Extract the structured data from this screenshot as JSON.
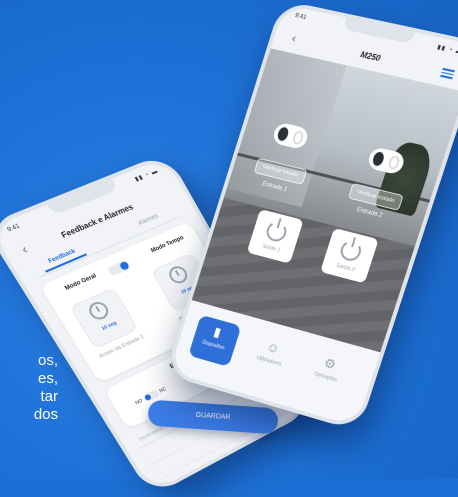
{
  "side_text": [
    "os,",
    "es,",
    "tar",
    "dos"
  ],
  "left_phone": {
    "status_time": "9:41",
    "title": "Feedback e Alarmes",
    "tabs": [
      "Feedback",
      "Alarmes"
    ],
    "mode_general": "Modo Geral",
    "mode_time": "Modo Tempo",
    "timers": [
      {
        "value": "10 seg",
        "caption": "Atraso da Entrada 1"
      },
      {
        "value": "10 seg",
        "caption": "Atraso da Entrada 2"
      }
    ],
    "entradas_title": "Entradas",
    "no_label": "NO",
    "nc_label": "NC",
    "email_placeholder": "Destinatário... 999 999 999",
    "save_label": "GUARDAR"
  },
  "right_phone": {
    "status_time": "9:41",
    "title": "M250",
    "verify_label": "Verificar estado",
    "entradas": [
      "Entrada 1",
      "Entrada 2"
    ],
    "saidas": [
      "Saída 1",
      "Saída 2"
    ],
    "nav": [
      "Dispositivo",
      "Utilizadores",
      "Definições"
    ]
  },
  "colors": {
    "accent": "#1f6ee0",
    "background": "#1c6fd4"
  }
}
